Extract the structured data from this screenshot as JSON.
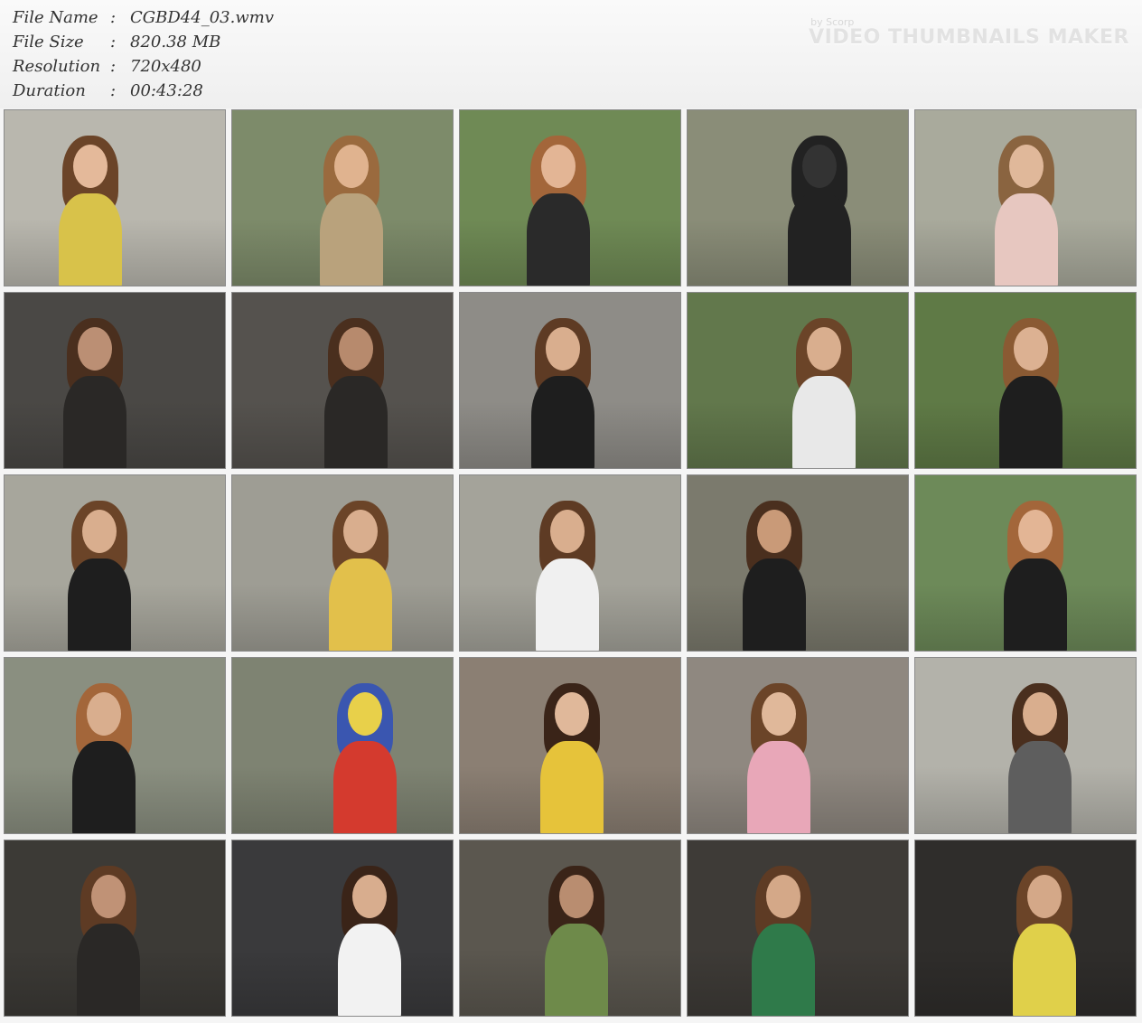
{
  "file_info": [
    {
      "key": "File Name",
      "sep": ":",
      "value": "CGBD44_03.wmv"
    },
    {
      "key": "File Size",
      "sep": ":",
      "value": "820.38 MB"
    },
    {
      "key": "Resolution",
      "sep": ":",
      "value": "720x480"
    },
    {
      "key": "Duration",
      "sep": ":",
      "value": "00:43:28"
    }
  ],
  "watermark": {
    "by": "by Scorp",
    "title": "VIDEO THUMBNAILS MAKER"
  },
  "thumbnails": [
    {
      "bg": "#b9b7ae",
      "accent": "#d8c24a",
      "skin": "#e4b99a",
      "hair": "#6b4428"
    },
    {
      "bg": "#7d8b6a",
      "accent": "#b9a27c",
      "skin": "#e0b38f",
      "hair": "#9a6a3e"
    },
    {
      "bg": "#6f8a55",
      "accent": "#2a2a2a",
      "skin": "#e3b595",
      "hair": "#a3663a"
    },
    {
      "bg": "#8a8d78",
      "accent": "#222222",
      "skin": "#333333",
      "hair": "#222222"
    },
    {
      "bg": "#a9aa9c",
      "accent": "#e7c7c0",
      "skin": "#e0b89a",
      "hair": "#8a6440"
    },
    {
      "bg": "#4a4845",
      "accent": "#2a2826",
      "skin": "#bb8f74",
      "hair": "#4a2f1e"
    },
    {
      "bg": "#55524e",
      "accent": "#2a2826",
      "skin": "#b78a6d",
      "hair": "#4a2f1e"
    },
    {
      "bg": "#8e8c87",
      "accent": "#1e1e1e",
      "skin": "#d9ae8e",
      "hair": "#5e3b24"
    },
    {
      "bg": "#62784c",
      "accent": "#e8e8e8",
      "skin": "#d9ae8e",
      "hair": "#6b4428"
    },
    {
      "bg": "#5f7a46",
      "accent": "#1e1e1e",
      "skin": "#dcb192",
      "hair": "#8a5a33"
    },
    {
      "bg": "#a7a69c",
      "accent": "#1e1e1e",
      "skin": "#d9ae8e",
      "hair": "#6b4428"
    },
    {
      "bg": "#9e9d94",
      "accent": "#e2c04b",
      "skin": "#d9ae8e",
      "hair": "#6b4428"
    },
    {
      "bg": "#a4a39a",
      "accent": "#f0f0f0",
      "skin": "#d9ae8e",
      "hair": "#5e3b24"
    },
    {
      "bg": "#7b7a6d",
      "accent": "#1e1e1e",
      "skin": "#c99a78",
      "hair": "#4a2f1e"
    },
    {
      "bg": "#6d8a59",
      "accent": "#1e1e1e",
      "skin": "#e3b595",
      "hair": "#a3663a"
    },
    {
      "bg": "#8a8f80",
      "accent": "#1e1e1e",
      "skin": "#d9ae8e",
      "hair": "#a3663a"
    },
    {
      "bg": "#7e8372",
      "accent": "#d43a2e",
      "skin": "#e8d04a",
      "hair": "#3a56b0"
    },
    {
      "bg": "#8b7f73",
      "accent": "#e6c33a",
      "skin": "#e0b89a",
      "hair": "#3a2418"
    },
    {
      "bg": "#8f8880",
      "accent": "#e8a7b8",
      "skin": "#e0b89a",
      "hair": "#6b4428"
    },
    {
      "bg": "#b3b2aa",
      "accent": "#5e5e5e",
      "skin": "#d9ae8e",
      "hair": "#4a2f1e"
    },
    {
      "bg": "#3c3a36",
      "accent": "#2a2826",
      "skin": "#c09276",
      "hair": "#5e3b24"
    },
    {
      "bg": "#3a3a3c",
      "accent": "#f2f2f2",
      "skin": "#d8ad8e",
      "hair": "#3a2418"
    },
    {
      "bg": "#5b574f",
      "accent": "#6e8a4a",
      "skin": "#b98d70",
      "hair": "#3a2418"
    },
    {
      "bg": "#3e3b37",
      "accent": "#2f7a4a",
      "skin": "#d4a888",
      "hair": "#5e3b24"
    },
    {
      "bg": "#2f2d2b",
      "accent": "#e0d04a",
      "skin": "#d4a888",
      "hair": "#6b4428"
    }
  ]
}
